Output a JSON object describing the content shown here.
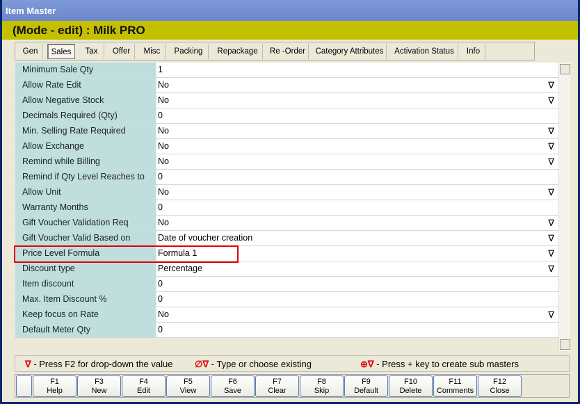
{
  "window": {
    "title": "Item Master"
  },
  "header": {
    "mode_text": "(Mode - edit)  :  Milk PRO"
  },
  "tabs": [
    {
      "label": "Gen"
    },
    {
      "label": "Sales"
    },
    {
      "label": "Tax"
    },
    {
      "label": "Offer"
    },
    {
      "label": "Misc"
    },
    {
      "label": "Packing"
    },
    {
      "label": "Repackage"
    },
    {
      "label": "Re -Order"
    },
    {
      "label": "Category Attributes"
    },
    {
      "label": "Activation Status"
    },
    {
      "label": "Info"
    }
  ],
  "active_tab": "Sales",
  "rows": [
    {
      "label": "Minimum Sale Qty",
      "value": "1",
      "dropdown": false
    },
    {
      "label": "Allow Rate Edit",
      "value": "No",
      "dropdown": true
    },
    {
      "label": "Allow Negative Stock",
      "value": "No",
      "dropdown": true
    },
    {
      "label": "Decimals Required (Qty)",
      "value": "0",
      "dropdown": false
    },
    {
      "label": "Min. Selling Rate Required",
      "value": "No",
      "dropdown": true
    },
    {
      "label": "Allow Exchange",
      "value": "No",
      "dropdown": true
    },
    {
      "label": "Remind while Billing",
      "value": "No",
      "dropdown": true
    },
    {
      "label": "Remind if Qty Level Reaches to",
      "value": "0",
      "dropdown": false
    },
    {
      "label": "Allow Unit",
      "value": "No",
      "dropdown": true
    },
    {
      "label": "Warranty Months",
      "value": "0",
      "dropdown": false
    },
    {
      "label": "Gift Voucher Validation Req",
      "value": "No",
      "dropdown": true
    },
    {
      "label": "Gift Voucher Valid Based on",
      "value": "Date of voucher creation",
      "dropdown": true
    },
    {
      "label": "Price Level Formula",
      "value": "Formula 1",
      "dropdown": true
    },
    {
      "label": "Discount type",
      "value": "Percentage",
      "dropdown": true
    },
    {
      "label": "Item discount",
      "value": "0",
      "dropdown": false
    },
    {
      "label": "Max. Item Discount %",
      "value": "0",
      "dropdown": false
    },
    {
      "label": "Keep focus on Rate",
      "value": "No",
      "dropdown": true
    },
    {
      "label": "Default Meter Qty",
      "value": "0",
      "dropdown": false
    }
  ],
  "dropdown_glyph": "∇",
  "legend": {
    "dropdown_icon": "∇",
    "dropdown_text": " - Press F2 for drop-down the value",
    "existing_icon": "∅∇",
    "existing_text": " - Type or choose existing",
    "sub_icon": "⊕∇",
    "sub_text": " - Press + key to create sub masters"
  },
  "fkeys": [
    {
      "key": "F1",
      "label": "Help"
    },
    {
      "key": "F3",
      "label": "New"
    },
    {
      "key": "F4",
      "label": "Edit"
    },
    {
      "key": "F5",
      "label": "View"
    },
    {
      "key": "F6",
      "label": "Save"
    },
    {
      "key": "F7",
      "label": "Clear"
    },
    {
      "key": "F8",
      "label": "Skip"
    },
    {
      "key": "F9",
      "label": "Default"
    },
    {
      "key": "F10",
      "label": "Delete"
    },
    {
      "key": "F11",
      "label": "Comments"
    },
    {
      "key": "F12",
      "label": "Close"
    }
  ],
  "colors": {
    "header": "#c4c000",
    "label_bg": "#bfdfdf",
    "highlight": "#e00000"
  }
}
